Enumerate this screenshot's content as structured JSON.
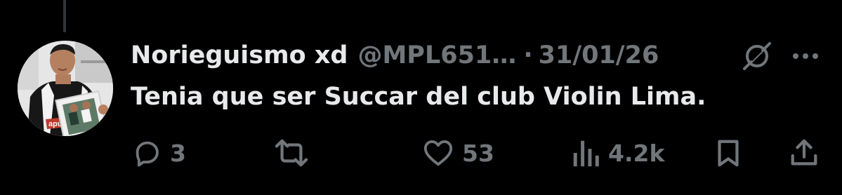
{
  "tweet": {
    "display_name": "Norieguismo xd",
    "handle": "@MPL651…",
    "separator": "·",
    "date": "31/01/26",
    "text": "Tenia que ser Succar del club Violin Lima."
  },
  "avatar": {
    "shirt_text": "apu"
  },
  "actions": {
    "reply_count": "3",
    "retweet_count": "",
    "like_count": "53",
    "views_count": "4.2k"
  },
  "icons": {
    "reply": "reply-icon",
    "retweet": "retweet-icon",
    "like": "heart-icon",
    "views": "views-icon",
    "bookmark": "bookmark-icon",
    "share": "share-icon",
    "grok": "grok-icon",
    "more": "more-icon"
  },
  "colors": {
    "background": "#000000",
    "primary_text": "#e7e9ea",
    "secondary_text": "#71767b",
    "thread_line": "#333639"
  }
}
